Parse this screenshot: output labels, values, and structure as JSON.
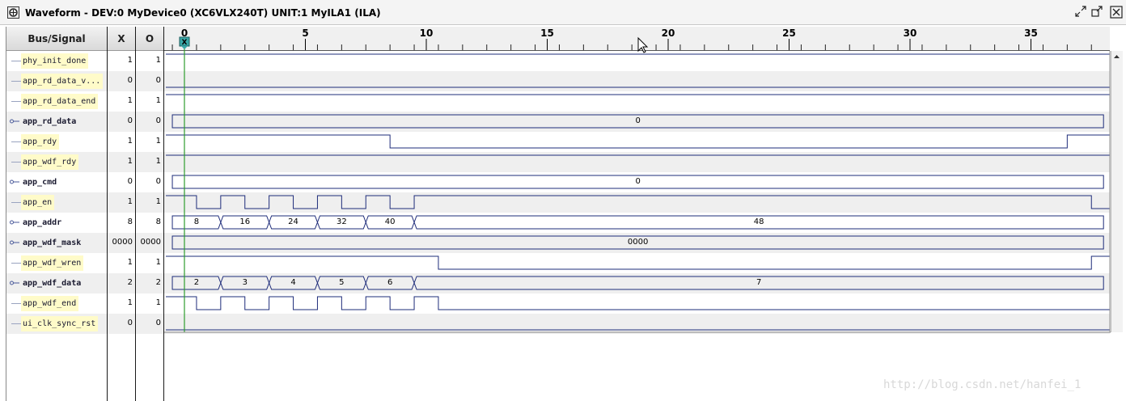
{
  "window": {
    "title": "Waveform - DEV:0 MyDevice0 (XC6VLX240T) UNIT:1 MyILA1 (ILA)",
    "icon": "waveform-window-icon",
    "controls": [
      "restore-icon",
      "maximize-icon",
      "close-icon"
    ]
  },
  "columns": {
    "bus_signal": "Bus/Signal",
    "x": "X",
    "o": "O"
  },
  "ruler": {
    "labels": [
      "0",
      "5",
      "10",
      "15",
      "20",
      "25",
      "30",
      "35"
    ]
  },
  "cursors": {
    "x_label": "X",
    "o_label": "O",
    "x_position": 0
  },
  "signals": [
    {
      "name": "phy_init_done",
      "bus": false,
      "x": "1",
      "o": "1"
    },
    {
      "name": "app_rd_data_v...",
      "bus": false,
      "x": "0",
      "o": "0"
    },
    {
      "name": "app_rd_data_end",
      "bus": false,
      "x": "1",
      "o": "1"
    },
    {
      "name": "app_rd_data",
      "bus": true,
      "x": "0",
      "o": "0"
    },
    {
      "name": "app_rdy",
      "bus": false,
      "x": "1",
      "o": "1"
    },
    {
      "name": "app_wdf_rdy",
      "bus": false,
      "x": "1",
      "o": "1"
    },
    {
      "name": "app_cmd",
      "bus": true,
      "x": "0",
      "o": "0"
    },
    {
      "name": "app_en",
      "bus": false,
      "x": "1",
      "o": "1"
    },
    {
      "name": "app_addr",
      "bus": true,
      "x": "8",
      "o": "8"
    },
    {
      "name": "app_wdf_mask",
      "bus": true,
      "x": "0000",
      "o": "0000"
    },
    {
      "name": "app_wdf_wren",
      "bus": false,
      "x": "1",
      "o": "1"
    },
    {
      "name": "app_wdf_data",
      "bus": true,
      "x": "2",
      "o": "2"
    },
    {
      "name": "app_wdf_end",
      "bus": false,
      "x": "1",
      "o": "1"
    },
    {
      "name": "ui_clk_sync_rst",
      "bus": false,
      "x": "0",
      "o": "0"
    }
  ],
  "waves": [
    {
      "type": "bit",
      "init": 1,
      "edges": []
    },
    {
      "type": "bit",
      "init": 0,
      "edges": []
    },
    {
      "type": "bit",
      "init": 1,
      "edges": []
    },
    {
      "type": "bus",
      "segments": [
        {
          "start": -0.5,
          "end": 38,
          "label": "0"
        }
      ]
    },
    {
      "type": "bit",
      "init": 1,
      "edges": [
        8.5,
        36.5
      ]
    },
    {
      "type": "bit",
      "init": 1,
      "edges": []
    },
    {
      "type": "bus",
      "segments": [
        {
          "start": -0.5,
          "end": 38,
          "label": "0"
        }
      ]
    },
    {
      "type": "bit",
      "init": 1,
      "edges": [
        0.5,
        1.5,
        2.5,
        3.5,
        4.5,
        5.5,
        6.5,
        7.5,
        8.5,
        9.5,
        37.5
      ]
    },
    {
      "type": "bus",
      "segments": [
        {
          "start": -0.5,
          "end": 1.5,
          "label": "8"
        },
        {
          "start": 1.5,
          "end": 3.5,
          "label": "16"
        },
        {
          "start": 3.5,
          "end": 5.5,
          "label": "24"
        },
        {
          "start": 5.5,
          "end": 7.5,
          "label": "32"
        },
        {
          "start": 7.5,
          "end": 9.5,
          "label": "40"
        },
        {
          "start": 9.5,
          "end": 38,
          "label": "48"
        }
      ]
    },
    {
      "type": "bus",
      "segments": [
        {
          "start": -0.5,
          "end": 38,
          "label": "0000"
        }
      ]
    },
    {
      "type": "bit",
      "init": 1,
      "edges": [
        10.5,
        37.5
      ]
    },
    {
      "type": "bus",
      "segments": [
        {
          "start": -0.5,
          "end": 1.5,
          "label": "2"
        },
        {
          "start": 1.5,
          "end": 3.5,
          "label": "3"
        },
        {
          "start": 3.5,
          "end": 5.5,
          "label": "4"
        },
        {
          "start": 5.5,
          "end": 7.5,
          "label": "5"
        },
        {
          "start": 7.5,
          "end": 9.5,
          "label": "6"
        },
        {
          "start": 9.5,
          "end": 38,
          "label": "7"
        }
      ]
    },
    {
      "type": "bit",
      "init": 1,
      "edges": [
        0.5,
        1.5,
        2.5,
        3.5,
        4.5,
        5.5,
        6.5,
        7.5,
        8.5,
        9.5,
        10.5
      ]
    },
    {
      "type": "bit",
      "init": 0,
      "edges": []
    }
  ],
  "watermark": "http://blog.csdn.net/hanfei_1"
}
